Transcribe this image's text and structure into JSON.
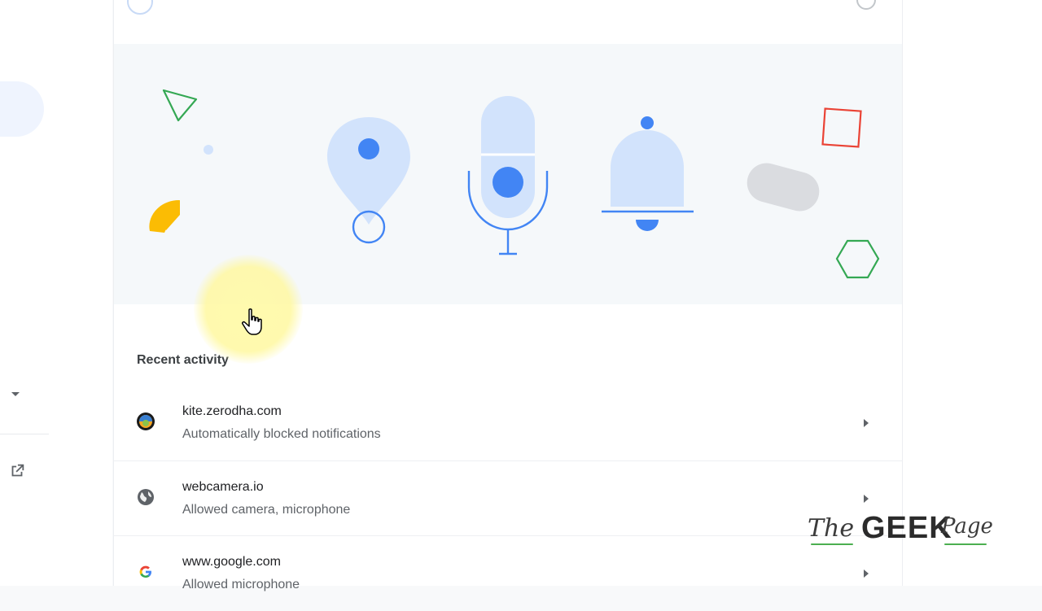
{
  "recent_activity": {
    "title": "Recent activity",
    "items": [
      {
        "site": "kite.zerodha.com",
        "status": "Automatically blocked notifications",
        "icon": "zerodha-favicon"
      },
      {
        "site": "webcamera.io",
        "status": "Allowed camera, microphone",
        "icon": "globe-icon"
      },
      {
        "site": "www.google.com",
        "status": "Allowed microphone",
        "icon": "google-favicon"
      }
    ]
  },
  "banner_icons": [
    "location-pin-icon",
    "microphone-icon",
    "notification-bell-icon"
  ],
  "watermark": {
    "the": "The",
    "geek": "GEEK",
    "page": "Page"
  },
  "colors": {
    "accent_blue": "#4285f4",
    "light_blue": "#d2e3fc",
    "red_square": "#ea4335",
    "green_shape": "#34a853",
    "yellow_shape": "#fbbc04"
  }
}
